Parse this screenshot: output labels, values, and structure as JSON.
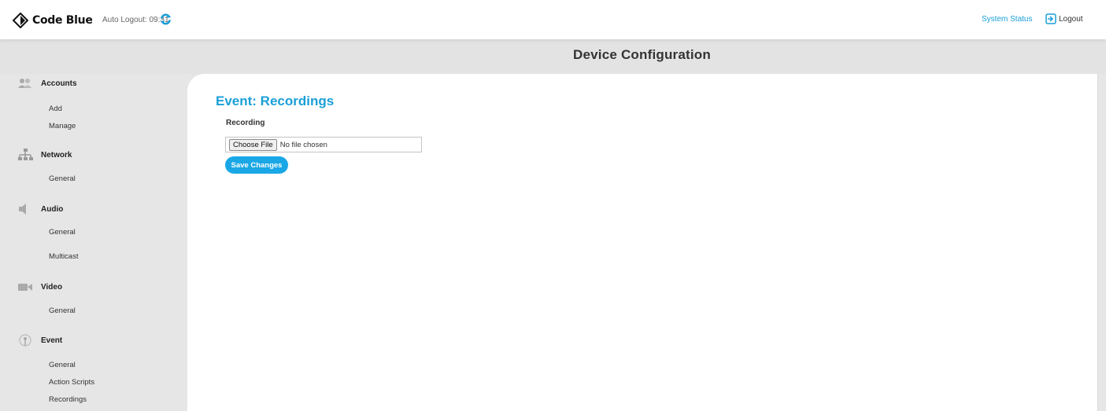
{
  "header": {
    "brand": "Code Blue",
    "auto_logout": "Auto Logout: 09:31",
    "system_status": "System Status",
    "logout": "Logout",
    "page_title": "Device Configuration"
  },
  "sidebar": {
    "sections": [
      {
        "label": "Accounts",
        "icon": "users-icon",
        "items": [
          "Add",
          "Manage"
        ]
      },
      {
        "label": "Network",
        "icon": "network-icon",
        "items": [
          "General"
        ]
      },
      {
        "label": "Audio",
        "icon": "speaker-icon",
        "items": [
          "General",
          "Multicast"
        ]
      },
      {
        "label": "Video",
        "icon": "camera-icon",
        "items": [
          "General"
        ]
      },
      {
        "label": "Event",
        "icon": "event-icon",
        "items": [
          "General",
          "Action Scripts",
          "Recordings"
        ]
      }
    ]
  },
  "main": {
    "title": "Event: Recordings",
    "field_label": "Recording",
    "choose_file": "Choose File",
    "no_file": "No file chosen",
    "save_button": "Save Changes"
  },
  "colors": {
    "accent": "#1a9fd8",
    "button": "#1aa7e6",
    "background": "#e6e6e6",
    "panel": "#ffffff"
  }
}
